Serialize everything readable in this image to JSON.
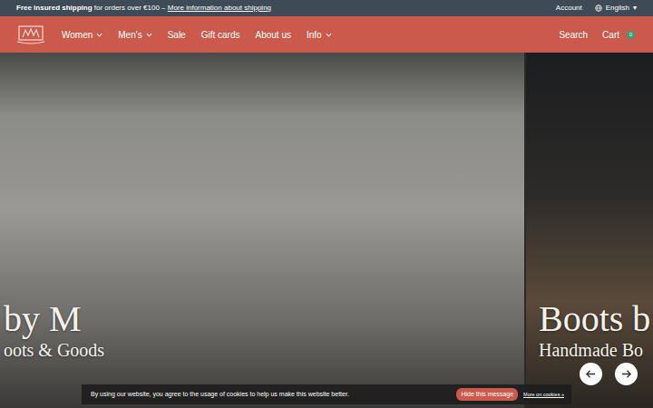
{
  "top_bar": {
    "shipping_bold": "Free insured shipping",
    "shipping_text": " for orders over €100 – ",
    "shipping_link": "More information about shipping",
    "account": "Account",
    "language": "English",
    "language_caret": "▾"
  },
  "nav": {
    "items": [
      {
        "label": "Women",
        "dropdown": true
      },
      {
        "label": "Men's",
        "dropdown": true
      },
      {
        "label": "Sale",
        "dropdown": false
      },
      {
        "label": "Gift cards",
        "dropdown": false
      },
      {
        "label": "About us",
        "dropdown": false
      },
      {
        "label": "Info",
        "dropdown": true
      }
    ],
    "search": "Search",
    "cart": "Cart",
    "cart_count": "0"
  },
  "slides": [
    {
      "title": "by M",
      "subtitle": "oots & Goods"
    },
    {
      "title": "Boots b",
      "subtitle": "Handmade Bo"
    }
  ],
  "cookie": {
    "text": "By using our website, you agree to the usage of cookies to help us make this website better.",
    "button": "Hide this message",
    "link": "More on cookies »"
  }
}
